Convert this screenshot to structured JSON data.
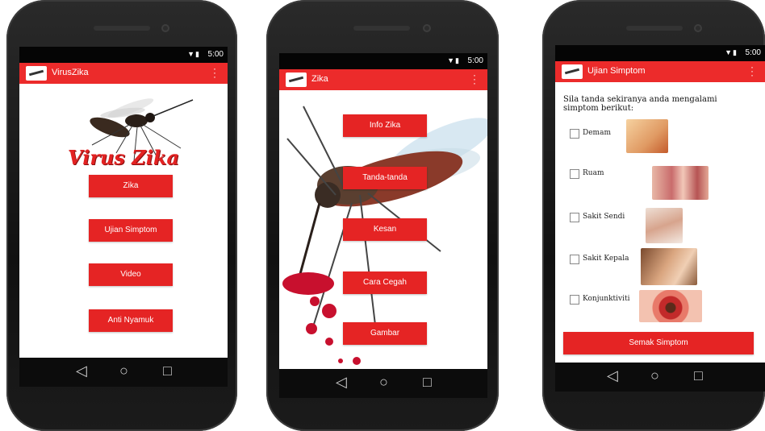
{
  "status_time": "5:00",
  "phone1": {
    "app_title": "VirusZika",
    "hero_title": "Virus Zika",
    "buttons": [
      "Zika",
      "Ujian Simptom",
      "Video",
      "Anti Nyamuk"
    ]
  },
  "phone2": {
    "app_title": "Zika",
    "buttons": [
      "Info Zika",
      "Tanda-tanda",
      "Kesan",
      "Cara Cegah",
      "Gambar"
    ]
  },
  "phone3": {
    "app_title": "Ujian Simptom",
    "prompt": "Sila tanda sekiranya anda mengalami simptom berikut:",
    "symptoms": [
      "Demam",
      "Ruam",
      "Sakit Sendi",
      "Sakit Kepala",
      "Konjunktiviti"
    ],
    "check_button": "Semak Simptom"
  },
  "colors": {
    "accent": "#ec2b2b",
    "button": "#e52424"
  }
}
